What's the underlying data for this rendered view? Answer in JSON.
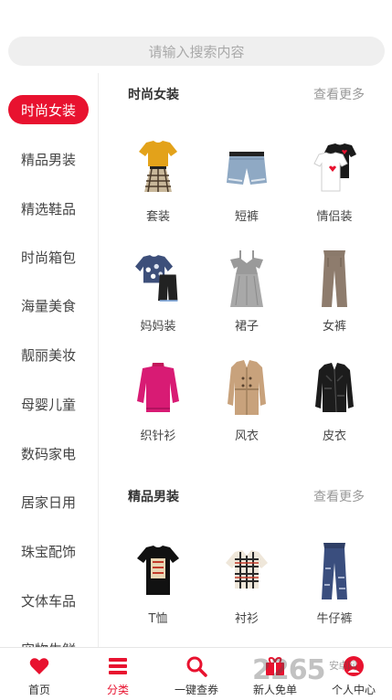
{
  "search": {
    "placeholder": "请输入搜索内容"
  },
  "sidebar": {
    "items": [
      {
        "label": "时尚女装",
        "active": true
      },
      {
        "label": "精品男装"
      },
      {
        "label": "精选鞋品"
      },
      {
        "label": "时尚箱包"
      },
      {
        "label": "海量美食"
      },
      {
        "label": "靓丽美妆"
      },
      {
        "label": "母婴儿童"
      },
      {
        "label": "数码家电"
      },
      {
        "label": "居家日用"
      },
      {
        "label": "珠宝配饰"
      },
      {
        "label": "文体车品"
      },
      {
        "label": "宠物生鲜"
      }
    ]
  },
  "sections": [
    {
      "title": "时尚女装",
      "more": "查看更多",
      "items": [
        {
          "label": "套装",
          "icon": "outfit-set-icon"
        },
        {
          "label": "短裤",
          "icon": "denim-shorts-icon"
        },
        {
          "label": "情侣装",
          "icon": "couple-tshirts-icon"
        },
        {
          "label": "妈妈装",
          "icon": "mom-outfit-icon"
        },
        {
          "label": "裙子",
          "icon": "dress-icon"
        },
        {
          "label": "女裤",
          "icon": "womens-pants-icon"
        },
        {
          "label": "织针衫",
          "icon": "knit-sweater-icon"
        },
        {
          "label": "风衣",
          "icon": "trench-coat-icon"
        },
        {
          "label": "皮衣",
          "icon": "leather-jacket-icon"
        }
      ]
    },
    {
      "title": "精品男装",
      "more": "查看更多",
      "items": [
        {
          "label": "T恤",
          "icon": "tshirt-icon"
        },
        {
          "label": "衬衫",
          "icon": "plaid-shirt-icon"
        },
        {
          "label": "牛仔裤",
          "icon": "jeans-icon"
        }
      ]
    }
  ],
  "tabbar": {
    "tabs": [
      {
        "label": "首页",
        "icon": "heart-icon"
      },
      {
        "label": "分类",
        "icon": "list-icon",
        "active": true
      },
      {
        "label": "一键查券",
        "icon": "search-icon"
      },
      {
        "label": "新人免单",
        "icon": "gift-icon"
      },
      {
        "label": "个人中心",
        "icon": "user-icon"
      }
    ]
  },
  "watermark": {
    "text": "2265",
    "sub": "安卓网"
  },
  "colors": {
    "accent": "#e8122f",
    "search_bg": "#efefef",
    "muted": "#999999"
  }
}
